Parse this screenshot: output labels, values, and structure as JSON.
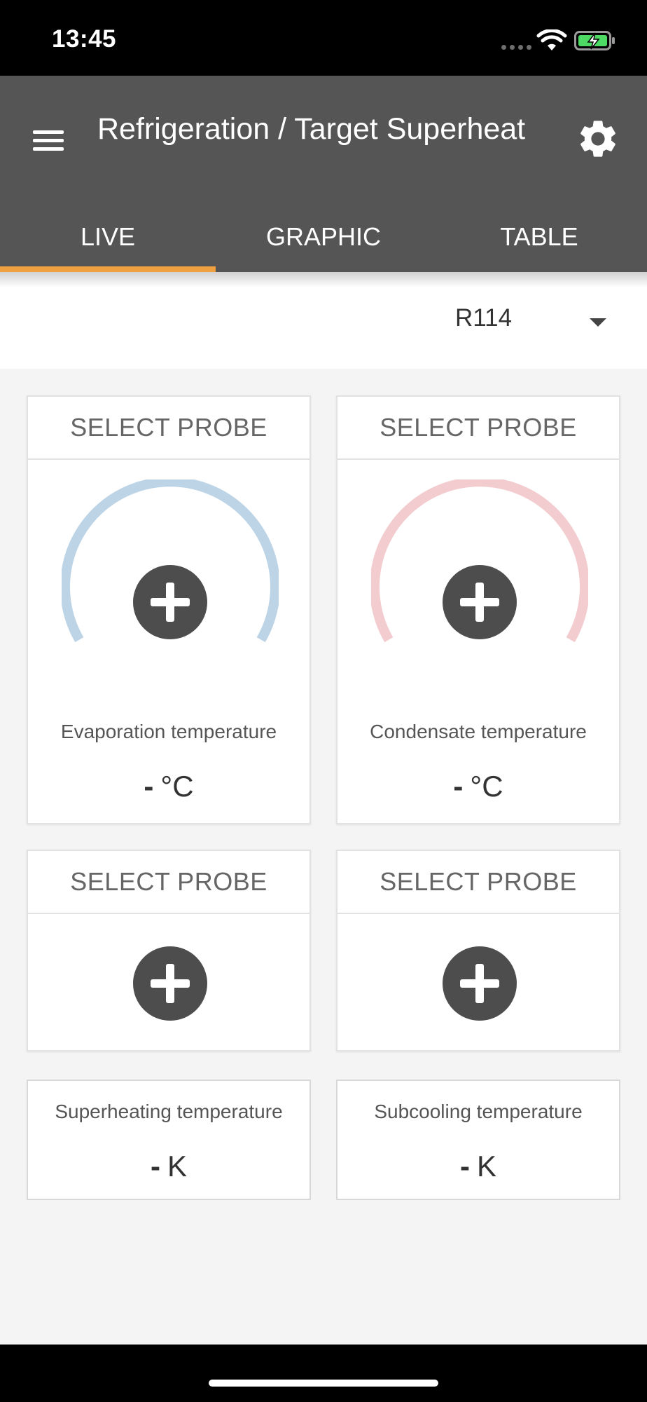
{
  "status_bar": {
    "time": "13:45"
  },
  "app_bar": {
    "title": "Refrigeration / Target Superheat"
  },
  "tabs": [
    {
      "label": "LIVE",
      "active": true
    },
    {
      "label": "GRAPHIC",
      "active": false
    },
    {
      "label": "TABLE",
      "active": false
    }
  ],
  "refrigerant": {
    "selected": "R114"
  },
  "probes": [
    {
      "header": "SELECT PROBE",
      "label": "Evaporation temperature",
      "value": "-",
      "unit": "°C",
      "gauge_color": "#bcd4e6"
    },
    {
      "header": "SELECT PROBE",
      "label": "Condensate temperature",
      "value": "-",
      "unit": "°C",
      "gauge_color": "#f2cccf"
    },
    {
      "header": "SELECT PROBE"
    },
    {
      "header": "SELECT PROBE"
    }
  ],
  "results": [
    {
      "label": "Superheating temperature",
      "value": "-",
      "unit": "K"
    },
    {
      "label": "Subcooling temperature",
      "value": "-",
      "unit": "K"
    }
  ],
  "colors": {
    "app_bar": "#555555",
    "tab_indicator": "#f0a040",
    "plus_button": "#4d4d4d"
  }
}
